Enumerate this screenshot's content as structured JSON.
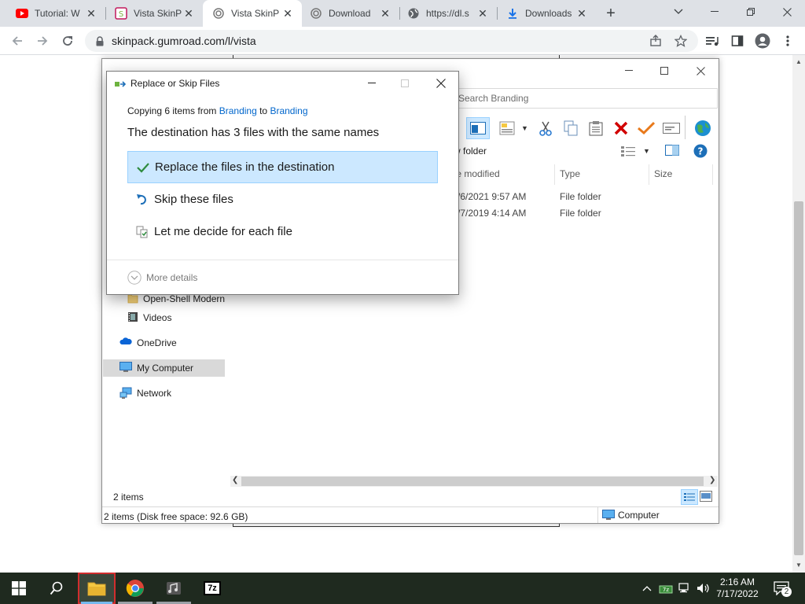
{
  "browser": {
    "tabs": [
      {
        "title": "Tutorial: W",
        "icon": "youtube-icon"
      },
      {
        "title": "Vista SkinP",
        "icon": "gumroad-icon"
      },
      {
        "title": "Vista SkinP",
        "icon": "gumroad-spiral-icon",
        "active": true
      },
      {
        "title": "Download",
        "icon": "gumroad-spiral-icon"
      },
      {
        "title": "https://dl.s",
        "icon": "globe-icon"
      },
      {
        "title": "Downloads",
        "icon": "download-icon"
      }
    ],
    "new_tab_label": "+",
    "url": "skinpack.gumroad.com/l/vista"
  },
  "explorer": {
    "search_placeholder": "Search Branding",
    "new_folder_label": "w folder",
    "columns": {
      "date": "te modified",
      "type": "Type",
      "size": "Size"
    },
    "rows": [
      {
        "date": "/6/2021 9:57 AM",
        "type": "File folder"
      },
      {
        "date": "/7/2019 4:14 AM",
        "type": "File folder"
      }
    ],
    "nav": {
      "open_shell": "Open-Shell Modern",
      "videos": "Videos",
      "onedrive": "OneDrive",
      "my_computer": "My Computer",
      "network": "Network"
    },
    "items_count": "2 items",
    "status_text": "2 items (Disk free space: 92.6 GB)",
    "status_location": "Computer"
  },
  "dialog": {
    "title": "Replace or Skip Files",
    "copying_prefix": "Copying 6 items from ",
    "source": "Branding",
    "to_word": " to ",
    "destination": "Branding",
    "heading": "The destination has 3 files with the same names",
    "options": {
      "replace": "Replace the files in the destination",
      "skip": "Skip these files",
      "decide": "Let me decide for each file"
    },
    "more_details": "More details"
  },
  "taskbar": {
    "time": "2:16 AM",
    "date": "7/17/2022",
    "notification_count": "2",
    "sevenzip_label": "7z"
  },
  "colors": {
    "accent": "#1a73e8",
    "selection": "#cce8ff",
    "link": "#0066cc"
  }
}
